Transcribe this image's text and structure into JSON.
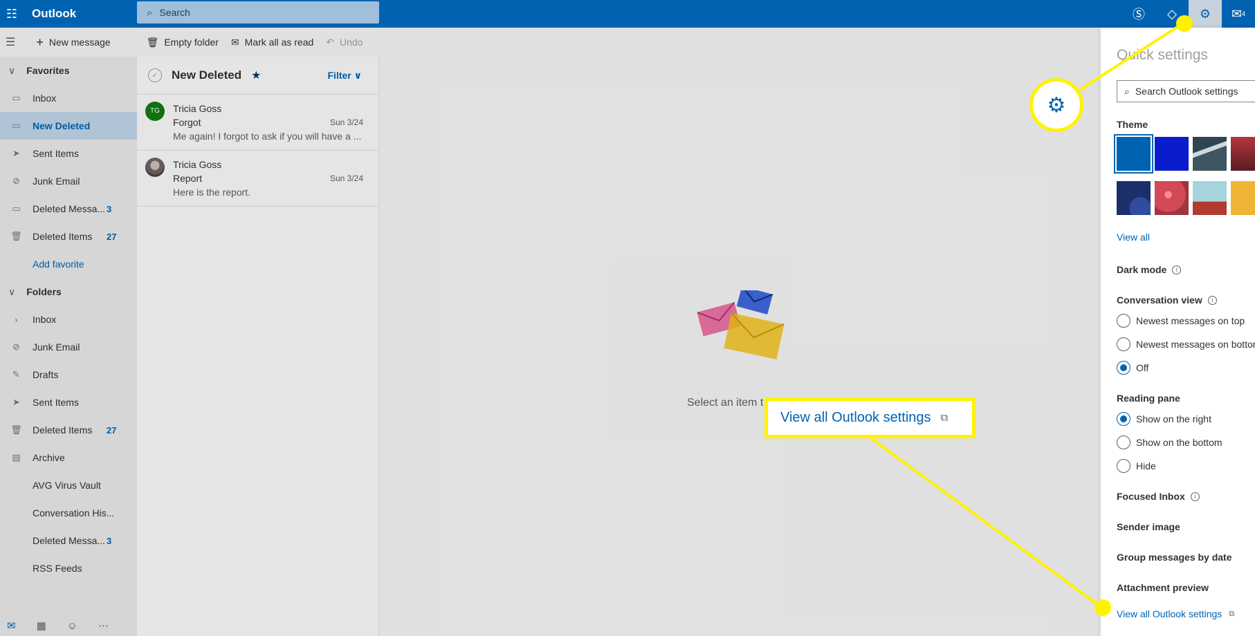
{
  "topbar": {
    "brand": "Outlook",
    "search_placeholder": "Search",
    "notification_count": "4"
  },
  "commands": {
    "new_message": "New message",
    "empty_folder": "Empty folder",
    "mark_all_read": "Mark all as read",
    "undo": "Undo"
  },
  "favorites": {
    "title": "Favorites",
    "items": [
      {
        "label": "Inbox",
        "count": ""
      },
      {
        "label": "New Deleted",
        "count": ""
      },
      {
        "label": "Sent Items",
        "count": ""
      },
      {
        "label": "Junk Email",
        "count": ""
      },
      {
        "label": "Deleted Messa...",
        "count": "3"
      },
      {
        "label": "Deleted Items",
        "count": "27"
      }
    ],
    "add_favorite": "Add favorite"
  },
  "folders": {
    "title": "Folders",
    "items": [
      {
        "label": "Inbox",
        "count": ""
      },
      {
        "label": "Junk Email",
        "count": ""
      },
      {
        "label": "Drafts",
        "count": ""
      },
      {
        "label": "Sent Items",
        "count": ""
      },
      {
        "label": "Deleted Items",
        "count": "27"
      },
      {
        "label": "Archive",
        "count": ""
      },
      {
        "label": "AVG Virus Vault",
        "count": ""
      },
      {
        "label": "Conversation His...",
        "count": ""
      },
      {
        "label": "Deleted Messa...",
        "count": "3"
      },
      {
        "label": "RSS Feeds",
        "count": ""
      }
    ]
  },
  "message_list": {
    "title": "New Deleted",
    "filter": "Filter",
    "messages": [
      {
        "initials": "TG",
        "sender": "Tricia Goss",
        "subject": "Forgot",
        "date": "Sun 3/24",
        "preview": "Me again! I forgot to ask if you will have a ..."
      },
      {
        "initials": "",
        "sender": "Tricia Goss",
        "subject": "Report",
        "date": "Sun 3/24",
        "preview": "Here is the report."
      }
    ]
  },
  "reading_pane": {
    "empty_text": "Select an item t"
  },
  "quick_settings": {
    "title": "Quick settings",
    "search_placeholder": "Search Outlook settings",
    "theme_label": "Theme",
    "view_all": "View all",
    "dark_mode": "Dark mode",
    "conversation_view": "Conversation view",
    "conv_options": [
      "Newest messages on top",
      "Newest messages on bottom",
      "Off"
    ],
    "conv_selected": 2,
    "reading_pane": "Reading pane",
    "reading_options": [
      "Show on the right",
      "Show on the bottom",
      "Hide"
    ],
    "reading_selected": 0,
    "focused_inbox": "Focused Inbox",
    "sender_image": "Sender image",
    "group_by_date": "Group messages by date",
    "attachment_preview": "Attachment preview",
    "view_all_settings": "View all Outlook settings"
  },
  "annotation": {
    "callout_text": "View all Outlook settings"
  },
  "colors": {
    "brand_blue": "#0063b1",
    "highlight_yellow": "#fff200"
  }
}
